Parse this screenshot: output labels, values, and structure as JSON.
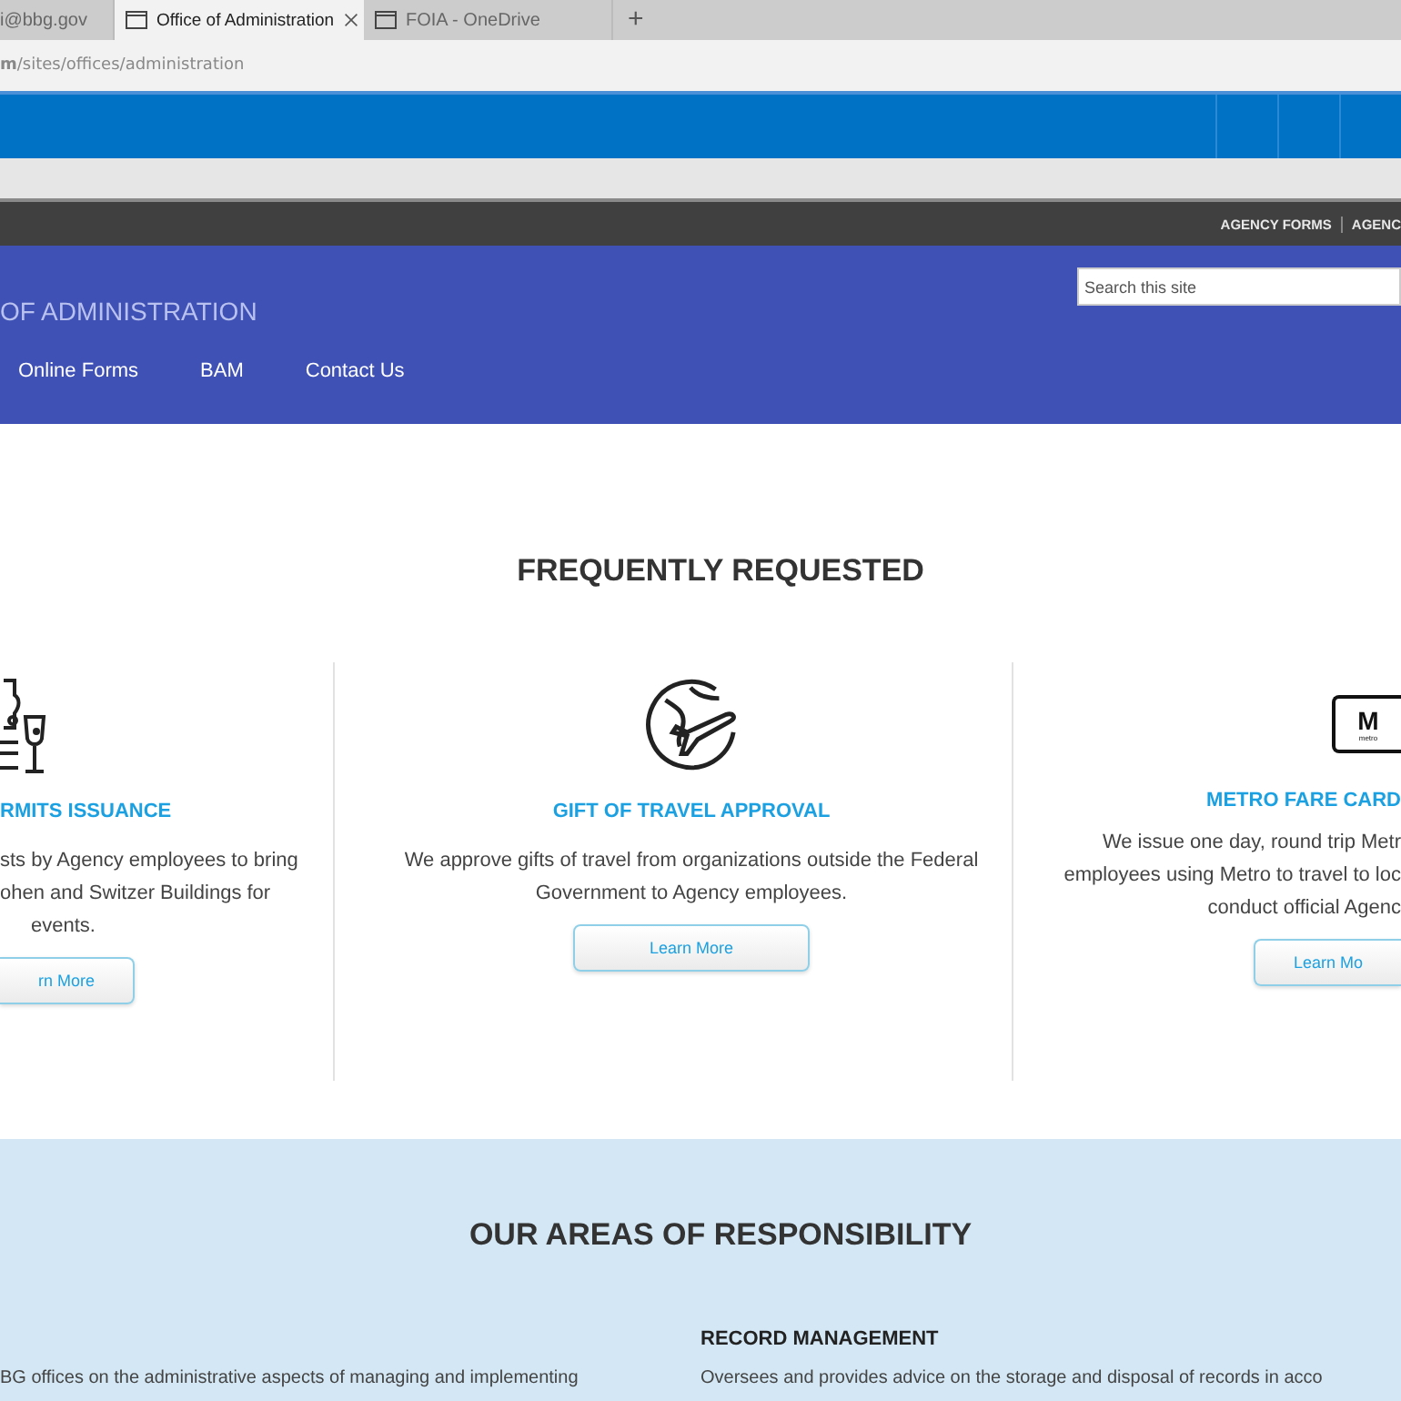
{
  "browser": {
    "tabs": [
      {
        "label": "i@bbg.gov",
        "selected": false
      },
      {
        "label": "Office of Administration",
        "selected": true
      },
      {
        "label": "FOIA - OneDrive",
        "selected": false
      }
    ],
    "new_tab": "+",
    "address": "**m**/sites/offices/administration"
  },
  "utility_links": [
    "AGENCY FORMS",
    "AGENC"
  ],
  "header": {
    "title": "OF ADMINISTRATION",
    "search": {
      "placeholder": "Search this site"
    },
    "nav": [
      "Online Forms",
      "BAM",
      "Contact Us"
    ]
  },
  "frequently_requested": {
    "heading": "FREQUENTLY REQUESTED",
    "cards": [
      {
        "kind": "cut-left",
        "title": "RMITS ISSUANCE",
        "lines": [
          "sts by Agency employees to bring",
          "ohen and Switzer Buildings for",
          "events."
        ],
        "button": "rn More"
      },
      {
        "kind": "whole",
        "title": "GIFT OF TRAVEL APPROVAL",
        "lines": [
          "We approve gifts of travel from organizations outside the Federal",
          "Government to Agency employees."
        ],
        "button": "Learn More"
      },
      {
        "kind": "cut-right",
        "sign_letter": "M",
        "sign_caption": "metro",
        "title": "METRO FARE CARD",
        "lines": [
          "We issue one day, round trip Metr",
          "employees using Metro to travel to loc",
          "conduct official Agenc"
        ],
        "button": "Learn Mo"
      }
    ]
  },
  "responsibility": {
    "heading": "OUR AREAS OF RESPONSIBILITY",
    "columns": [
      {
        "text": "BG offices on the administrative aspects of managing and implementing"
      },
      {
        "title": "RECORD MANAGEMENT",
        "text": "Oversees and provides advice on the storage and disposal of records in acco"
      }
    ]
  }
}
